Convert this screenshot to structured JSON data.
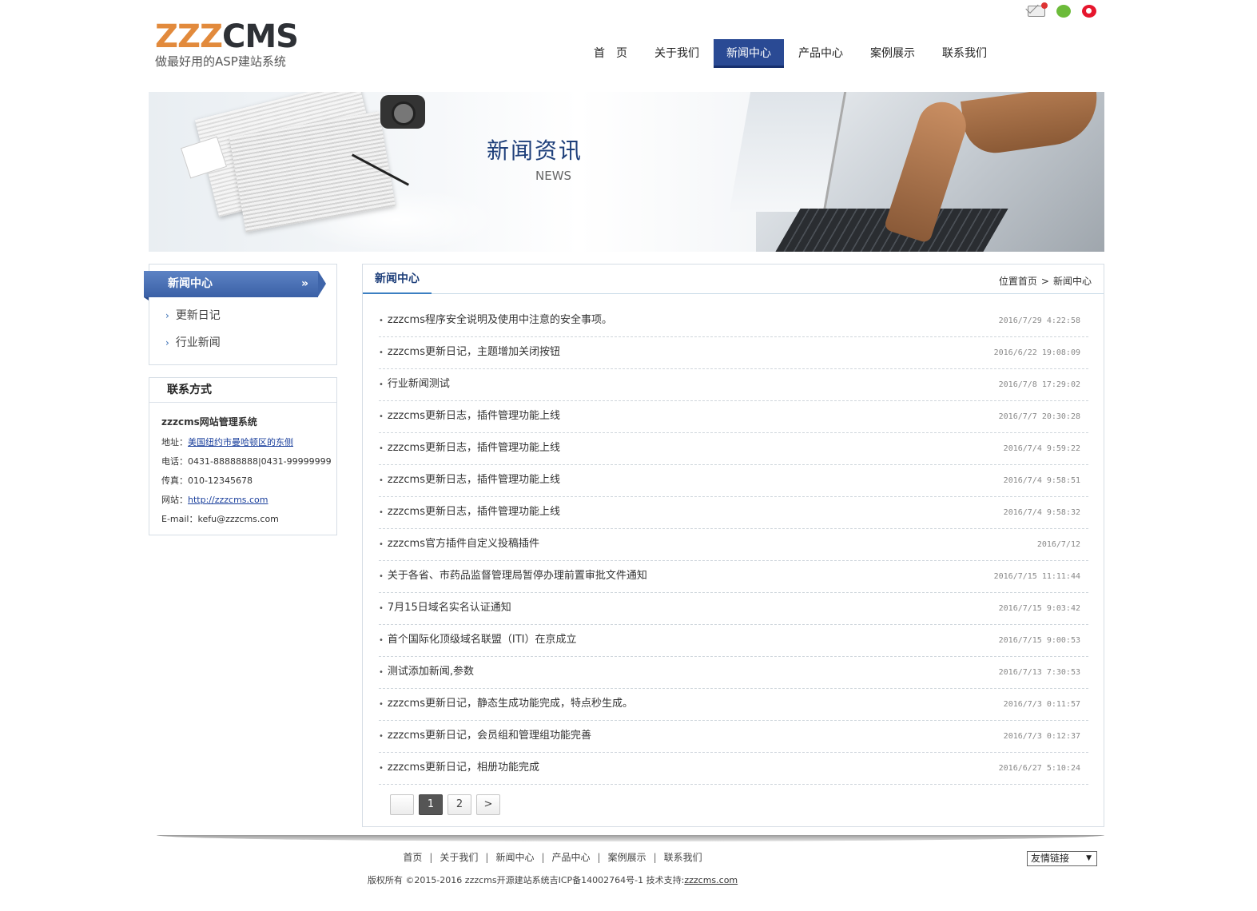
{
  "logo": {
    "main_z": "ZZZ",
    "main_c": "CMS",
    "slogan": "做最好用的ASP建站系统"
  },
  "social": {
    "icons": [
      "mail-icon",
      "wechat-icon",
      "weibo-icon"
    ]
  },
  "nav": {
    "items": [
      "首　页",
      "关于我们",
      "新闻中心",
      "产品中心",
      "案例展示",
      "联系我们"
    ],
    "active_index": 2
  },
  "banner": {
    "title": "新闻资讯",
    "subtitle": "NEWS"
  },
  "sidebar": {
    "title": "新闻中心",
    "arrow": "»",
    "items": [
      "更新日记",
      "行业新闻"
    ]
  },
  "contact": {
    "title": "联系方式",
    "company": "zzzcms网站管理系统",
    "address_label": "地址：",
    "address": "美国纽约市曼哈顿区的东侧",
    "phone_label": "电话：",
    "phone": "0431-88888888|0431-99999999",
    "fax_label": "传真：",
    "fax": "010-12345678",
    "site_label": "网站：",
    "site": "http://zzzcms.com",
    "email_label": "E-mail：",
    "email": "kefu@zzzcms.com"
  },
  "main": {
    "title": "新闻中心",
    "breadcrumb": {
      "prefix": "位置",
      "home": "首页",
      "sep": ">",
      "current": "新闻中心"
    },
    "news": [
      {
        "title": "zzzcms程序安全说明及使用中注意的安全事项。",
        "date": "2016/7/29 4:22:58"
      },
      {
        "title": "zzzcms更新日记，主题增加关闭按钮",
        "date": "2016/6/22 19:08:09"
      },
      {
        "title": "行业新闻测试",
        "date": "2016/7/8 17:29:02"
      },
      {
        "title": "zzzcms更新日志，插件管理功能上线",
        "date": "2016/7/7 20:30:28"
      },
      {
        "title": "zzzcms更新日志，插件管理功能上线",
        "date": "2016/7/4 9:59:22"
      },
      {
        "title": "zzzcms更新日志，插件管理功能上线",
        "date": "2016/7/4 9:58:51"
      },
      {
        "title": "zzzcms更新日志，插件管理功能上线",
        "date": "2016/7/4 9:58:32"
      },
      {
        "title": "zzzcms官方插件自定义投稿插件",
        "date": "2016/7/12"
      },
      {
        "title": "关于各省、市药品监督管理局暂停办理前置审批文件通知",
        "date": "2016/7/15 11:11:44"
      },
      {
        "title": "7月15日域名实名认证通知",
        "date": "2016/7/15 9:03:42"
      },
      {
        "title": "首个国际化顶级域名联盟（ITI）在京成立",
        "date": "2016/7/15 9:00:53"
      },
      {
        "title": "测试添加新闻,参数",
        "date": "2016/7/13 7:30:53"
      },
      {
        "title": "zzzcms更新日记，静态生成功能完成，特点秒生成。",
        "date": "2016/7/3 0:11:57"
      },
      {
        "title": "zzzcms更新日记，会员组和管理组功能完善",
        "date": "2016/7/3 0:12:37"
      },
      {
        "title": "zzzcms更新日记，相册功能完成",
        "date": "2016/6/27 5:10:24"
      }
    ],
    "bullet": "•",
    "pager": {
      "blank": "",
      "pages": [
        "1",
        "2"
      ],
      "current": "1",
      "next": ">"
    }
  },
  "footer": {
    "links": [
      "首页",
      "关于我们",
      "新闻中心",
      "产品中心",
      "案例展示",
      "联系我们"
    ],
    "sep": "|",
    "copyright": "版权所有 ©2015-2016 zzzcms开源建站系统吉ICP备14002764号-1 技术支持:",
    "support_link": "zzzcms.com",
    "friend_links": "友情链接"
  }
}
